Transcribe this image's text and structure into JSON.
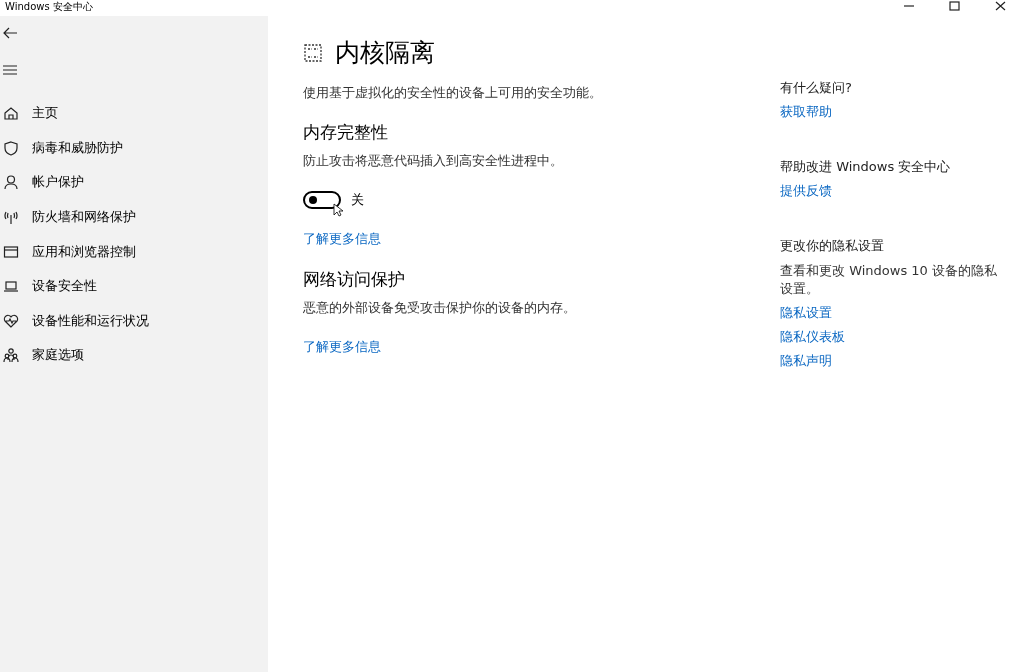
{
  "window": {
    "title": "Windows 安全中心"
  },
  "sidebar": {
    "items": [
      {
        "label": "主页"
      },
      {
        "label": "病毒和威胁防护"
      },
      {
        "label": "帐户保护"
      },
      {
        "label": "防火墙和网络保护"
      },
      {
        "label": "应用和浏览器控制"
      },
      {
        "label": "设备安全性"
      },
      {
        "label": "设备性能和运行状况"
      },
      {
        "label": "家庭选项"
      }
    ]
  },
  "main": {
    "title": "内核隔离",
    "description": "使用基于虚拟化的安全性的设备上可用的安全功能。",
    "sections": [
      {
        "kind": "toggle",
        "heading": "内存完整性",
        "description": "防止攻击将恶意代码插入到高安全性进程中。",
        "toggle": {
          "on": false,
          "label": "关"
        },
        "link": "了解更多信息"
      },
      {
        "kind": "plain",
        "heading": "网络访问保护",
        "description": "恶意的外部设备免受攻击保护你的设备的内存。",
        "link": "了解更多信息"
      }
    ]
  },
  "side_panel": {
    "groups": [
      {
        "heading": "有什么疑问?",
        "links": [
          "获取帮助"
        ]
      },
      {
        "heading": "帮助改进 Windows 安全中心",
        "links": [
          "提供反馈"
        ]
      },
      {
        "heading": "更改你的隐私设置",
        "description": "查看和更改 Windows 10 设备的隐私设置。",
        "links": [
          "隐私设置",
          "隐私仪表板",
          "隐私声明"
        ]
      }
    ]
  }
}
